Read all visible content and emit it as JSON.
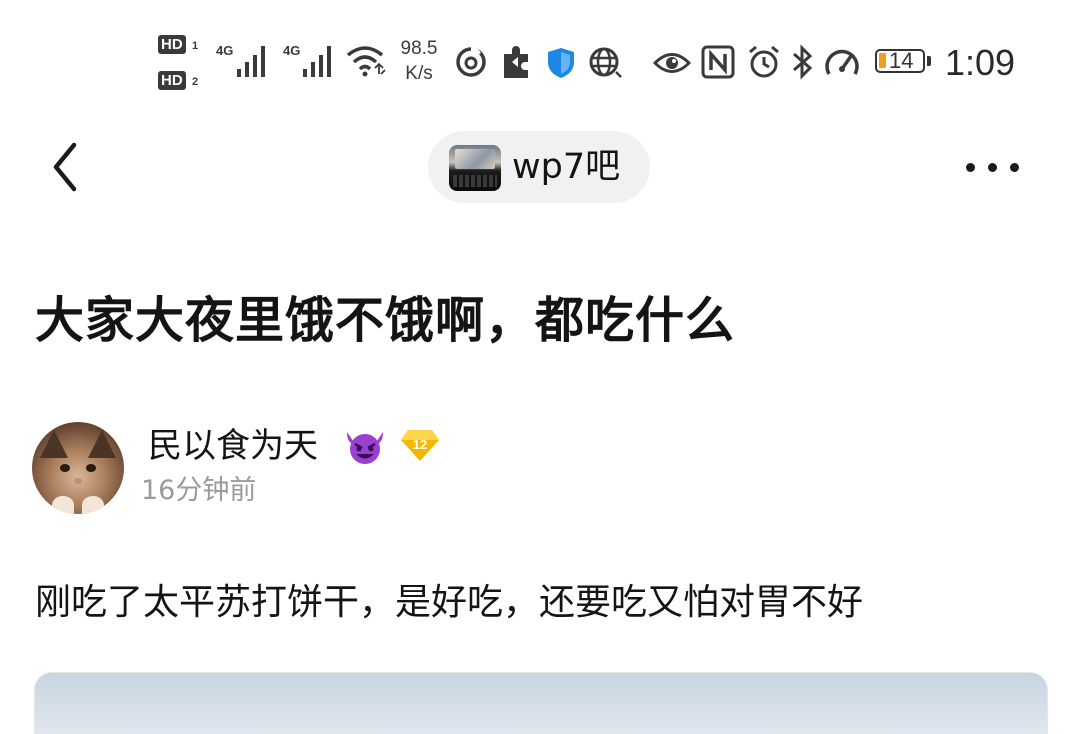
{
  "status_bar": {
    "sim1_label": "HD",
    "sim1_index": "1",
    "sim2_label": "HD",
    "sim2_index": "2",
    "network1": "4G",
    "network2": "4G",
    "speed_value": "98.5",
    "speed_unit": "K/s",
    "app_icons": [
      "netease-music-icon",
      "puzzle-app-icon",
      "shield-app-icon",
      "globe-app-icon"
    ],
    "system_icons": [
      "eye-icon",
      "nfc-icon",
      "alarm-icon",
      "bluetooth-icon",
      "speedometer-icon"
    ],
    "battery_level": "14",
    "battery_color": "#f0a020",
    "time": "1:09"
  },
  "header": {
    "back_icon": "chevron-left-icon",
    "forum_name": "wp7吧",
    "more_icon": "more-dots-icon"
  },
  "post": {
    "title": "大家大夜里饿不饿啊，都吃什么",
    "author": {
      "name": "民以食为天",
      "emoji": "devil-emoji-icon",
      "level": "12",
      "level_color": "#f5b800"
    },
    "time": "16分钟前",
    "body": "刚吃了太平苏打饼干，是好吃，还要吃又怕对胃不好"
  }
}
